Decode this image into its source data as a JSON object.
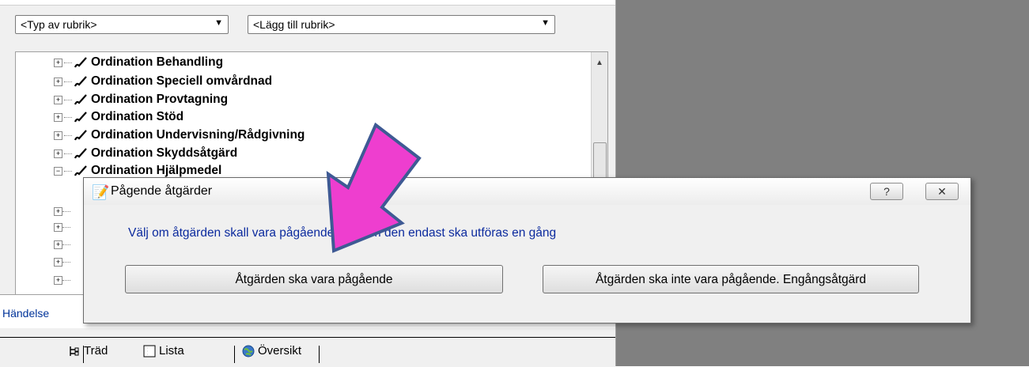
{
  "toolbar": {
    "heading_type_value": "<Typ av rubrik>",
    "add_heading_value": "<Lägg till rubrik>"
  },
  "tree": {
    "items": [
      {
        "label": "Ordination Behandling"
      },
      {
        "label": "Ordination Speciell omvårdnad"
      },
      {
        "label": "Ordination Provtagning"
      },
      {
        "label": "Ordination Stöd"
      },
      {
        "label": "Ordination Undervisning/Rådgivning"
      },
      {
        "label": "Ordination Skyddsåtgärd"
      },
      {
        "label": "Ordination Hjälpmedel"
      }
    ]
  },
  "events_tab": {
    "label": "Händelse"
  },
  "bottom_tabs": [
    {
      "label": "Träd",
      "icon": "tree-icon"
    },
    {
      "label": "Lista",
      "icon": "list-icon"
    },
    {
      "label": "Översikt",
      "icon": "globe-icon"
    }
  ],
  "dialog": {
    "title": "Pågende åtgärder",
    "help_label": "?",
    "close_label": "✕",
    "message": "Välj om åtgärden skall vara pågående eller om den endast ska utföras en gång",
    "btn_ongoing": "Åtgärden ska vara pågående",
    "btn_once": "Åtgärden ska inte vara pågående. Engångsåtgärd"
  },
  "colors": {
    "annotation_arrow_fill": "#ee3ecf",
    "annotation_arrow_stroke": "#3e5a94",
    "dialog_message": "#0b2a9e"
  }
}
